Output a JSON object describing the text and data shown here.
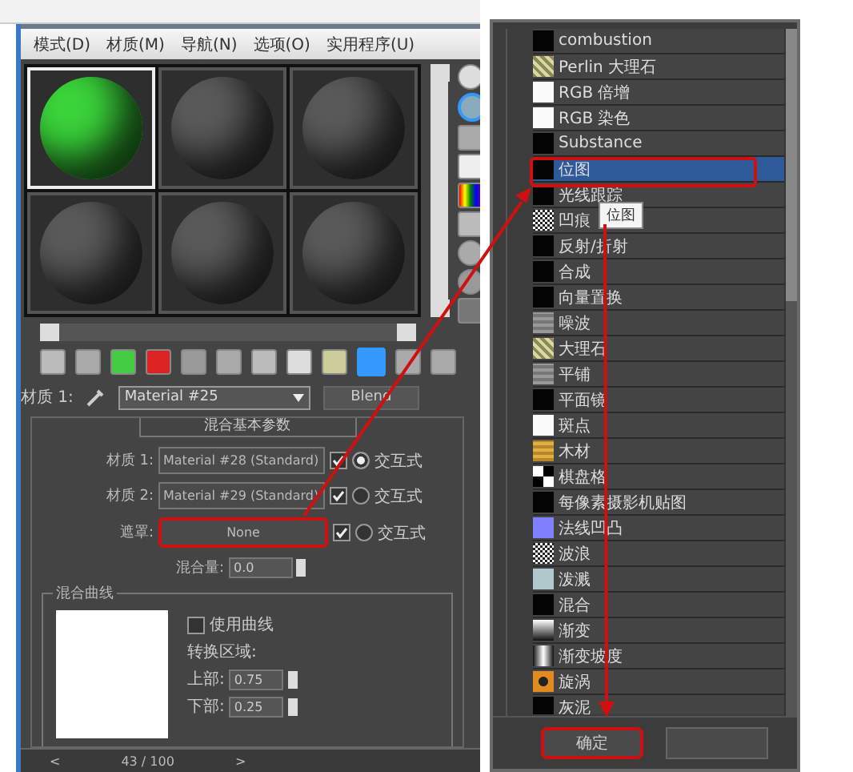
{
  "menu": [
    "模式(D)",
    "材质(M)",
    "导航(N)",
    "选项(O)",
    "实用程序(U)"
  ],
  "sample_slots": [
    {
      "selected": true,
      "color": "#3ad43a"
    },
    {
      "selected": false,
      "color": "#5a5a5a"
    },
    {
      "selected": false,
      "color": "#5a5a5a"
    },
    {
      "selected": false,
      "color": "#5a5a5a"
    },
    {
      "selected": false,
      "color": "#5a5a5a"
    },
    {
      "selected": false,
      "color": "#5a5a5a"
    }
  ],
  "material_row": {
    "label": "材质 1:",
    "value": "Material #25",
    "type_button": "Blend"
  },
  "rollout": {
    "title": "混合基本参数",
    "slots": [
      {
        "label": "材质 1:",
        "value": "Material #28 (Standard)",
        "checked": true,
        "selected": true,
        "option": "交互式",
        "highlighted": false
      },
      {
        "label": "材质 2:",
        "value": "Material #29 (Standard)",
        "checked": true,
        "selected": false,
        "option": "交互式",
        "highlighted": false
      },
      {
        "label": "遮罩:",
        "value": "None",
        "checked": true,
        "selected": false,
        "option": "交互式",
        "highlighted": true
      }
    ],
    "mix_amount": {
      "label": "混合量:",
      "value": "0.0"
    },
    "curve": {
      "title": "混合曲线",
      "use_curve": {
        "label": "使用曲线",
        "checked": false
      },
      "zone_label": "转换区域:",
      "upper": {
        "label": "上部:",
        "value": "0.75"
      },
      "lower": {
        "label": "下部:",
        "value": "0.25"
      }
    }
  },
  "pager": {
    "prev": "<",
    "page": "43 / 100",
    "next": ">"
  },
  "map_list": [
    {
      "label": "combustion",
      "kind": "dark",
      "selected": false
    },
    {
      "label": "Perlin 大理石",
      "kind": "marble",
      "selected": false
    },
    {
      "label": "RGB 倍增",
      "kind": "light",
      "selected": false
    },
    {
      "label": "RGB 染色",
      "kind": "light",
      "selected": false
    },
    {
      "label": "Substance",
      "kind": "dark",
      "selected": false
    },
    {
      "label": "位图",
      "kind": "dark",
      "selected": true
    },
    {
      "label": "光线跟踪",
      "kind": "dark",
      "selected": false
    },
    {
      "label": "凹痕",
      "kind": "noise",
      "selected": false
    },
    {
      "label": "反射/折射",
      "kind": "dark",
      "selected": false
    },
    {
      "label": "合成",
      "kind": "dark",
      "selected": false
    },
    {
      "label": "向量置换",
      "kind": "dark",
      "selected": false
    },
    {
      "label": "噪波",
      "kind": "grey",
      "selected": false
    },
    {
      "label": "大理石",
      "kind": "marble",
      "selected": false
    },
    {
      "label": "平铺",
      "kind": "grey",
      "selected": false
    },
    {
      "label": "平面镜",
      "kind": "dark",
      "selected": false
    },
    {
      "label": "斑点",
      "kind": "light",
      "selected": false
    },
    {
      "label": "木材",
      "kind": "wood",
      "selected": false
    },
    {
      "label": "棋盘格",
      "kind": "checker",
      "selected": false
    },
    {
      "label": "每像素摄影机贴图",
      "kind": "dark",
      "selected": false
    },
    {
      "label": "法线凹凸",
      "kind": "blue",
      "selected": false
    },
    {
      "label": "波浪",
      "kind": "noise",
      "selected": false
    },
    {
      "label": "泼溅",
      "kind": "pale",
      "selected": false
    },
    {
      "label": "混合",
      "kind": "dark",
      "selected": false
    },
    {
      "label": "渐变",
      "kind": "gradient",
      "selected": false
    },
    {
      "label": "渐变坡度",
      "kind": "ramp",
      "selected": false
    },
    {
      "label": "旋涡",
      "kind": "swirl",
      "selected": false
    },
    {
      "label": "灰泥",
      "kind": "dark",
      "selected": false
    }
  ],
  "tooltip": "位图",
  "dialog_buttons": [
    {
      "label": "确定",
      "highlighted": true
    },
    {
      "highlighted": false
    }
  ]
}
